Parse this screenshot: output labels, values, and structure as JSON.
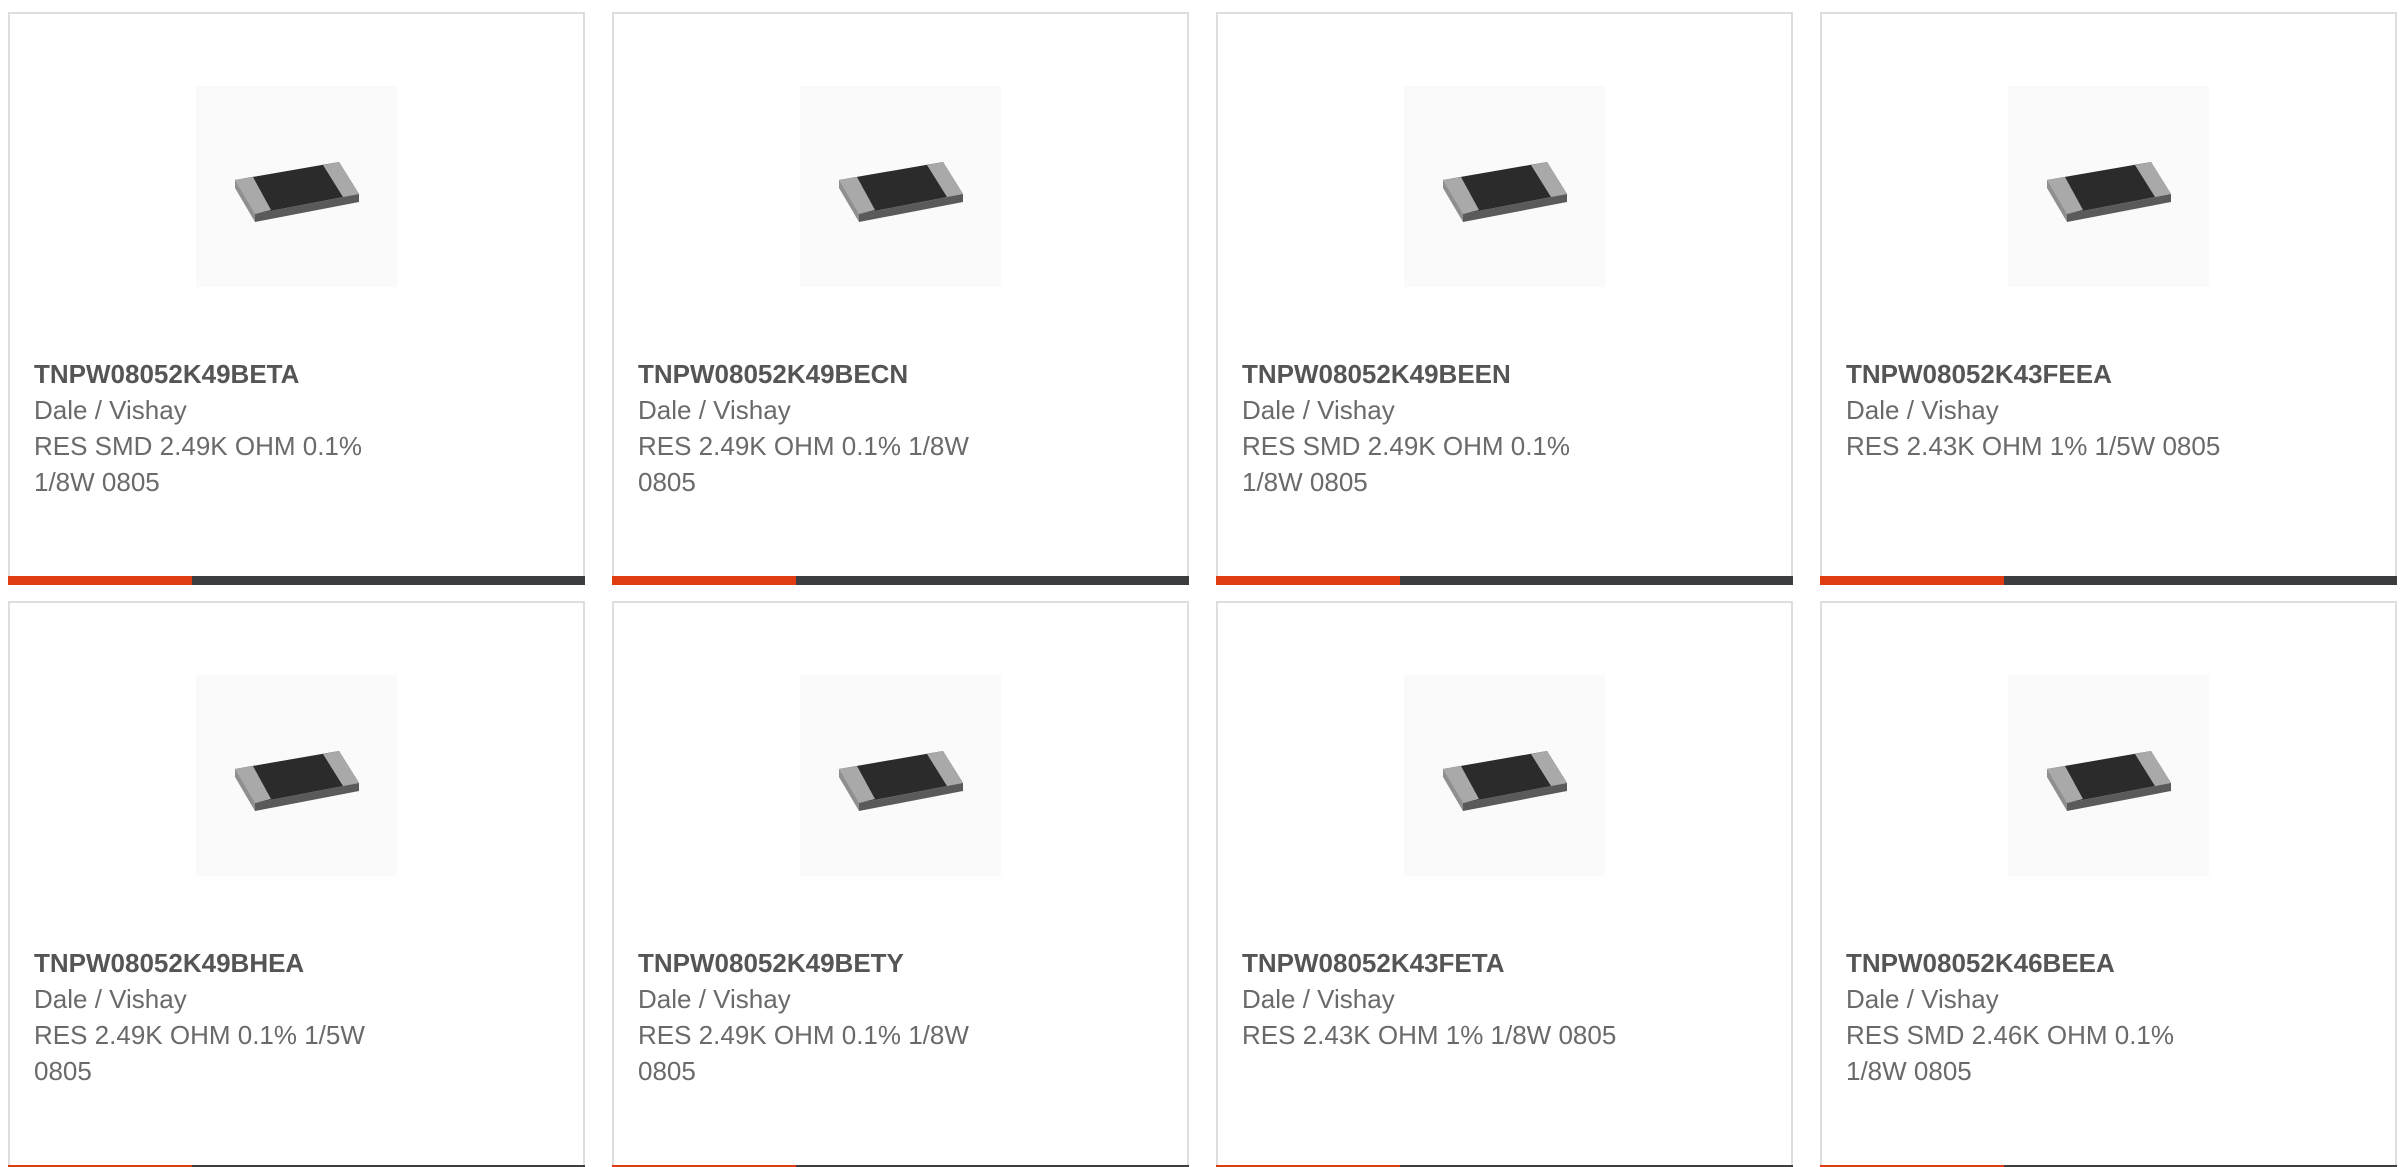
{
  "products": [
    {
      "part": "TNPW08052K49BETA",
      "manufacturer": "Dale / Vishay",
      "description": "RES SMD 2.49K OHM 0.1% 1/8W 0805",
      "image_icon": "smd-resistor-icon"
    },
    {
      "part": "TNPW08052K49BECN",
      "manufacturer": "Dale / Vishay",
      "description": "RES 2.49K OHM 0.1% 1/8W 0805",
      "image_icon": "smd-resistor-icon"
    },
    {
      "part": "TNPW08052K49BEEN",
      "manufacturer": "Dale / Vishay",
      "description": "RES SMD 2.49K OHM 0.1% 1/8W 0805",
      "image_icon": "smd-resistor-icon"
    },
    {
      "part": "TNPW08052K43FEEA",
      "manufacturer": "Dale / Vishay",
      "description": "RES 2.43K OHM 1% 1/5W 0805",
      "image_icon": "smd-resistor-icon"
    },
    {
      "part": "TNPW08052K49BHEA",
      "manufacturer": "Dale / Vishay",
      "description": "RES 2.49K OHM 0.1% 1/5W 0805",
      "image_icon": "smd-resistor-icon"
    },
    {
      "part": "TNPW08052K49BETY",
      "manufacturer": "Dale / Vishay",
      "description": "RES 2.49K OHM 0.1% 1/8W 0805",
      "image_icon": "smd-resistor-icon"
    },
    {
      "part": "TNPW08052K43FETA",
      "manufacturer": "Dale / Vishay",
      "description": "RES 2.43K OHM 1% 1/8W 0805",
      "image_icon": "smd-resistor-icon"
    },
    {
      "part": "TNPW08052K46BEEA",
      "manufacturer": "Dale / Vishay",
      "description": "RES SMD 2.46K OHM 0.1% 1/8W 0805",
      "image_icon": "smd-resistor-icon"
    }
  ],
  "colors": {
    "accent": "#e03c12",
    "bar": "#3b3d3f",
    "border": "#dedede",
    "text": "#6a6a6a"
  }
}
